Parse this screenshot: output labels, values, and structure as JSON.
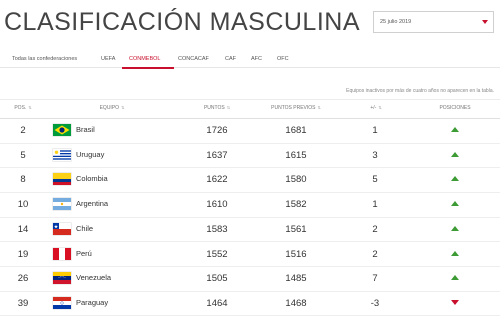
{
  "page": {
    "title": "CLASIFICACIÓN MASCULINA",
    "date": "25 julio 2019",
    "note": "Equipos inactivos por más de cuatro años no aparecen en la tabla."
  },
  "tabs": [
    {
      "label": "Todas las confederaciones",
      "active": false
    },
    {
      "label": "UEFA",
      "active": false
    },
    {
      "label": "CONMEBOL",
      "active": true
    },
    {
      "label": "CONCACAF",
      "active": false
    },
    {
      "label": "CAF",
      "active": false
    },
    {
      "label": "AFC",
      "active": false
    },
    {
      "label": "OFC",
      "active": false
    }
  ],
  "columns": {
    "pos": "POS.",
    "team": "EQUIPO",
    "points": "PUNTOS",
    "prev_points": "PUNTOS PREVIOS",
    "change": "+/-",
    "positions": "POSICIONES"
  },
  "rows": [
    {
      "pos": "2",
      "team": "Brasil",
      "points": "1726",
      "prev": "1681",
      "change": "1",
      "trend": "up",
      "flag": "brazil-flag-icon"
    },
    {
      "pos": "5",
      "team": "Uruguay",
      "points": "1637",
      "prev": "1615",
      "change": "3",
      "trend": "up",
      "flag": "uruguay-flag-icon"
    },
    {
      "pos": "8",
      "team": "Colombia",
      "points": "1622",
      "prev": "1580",
      "change": "5",
      "trend": "up",
      "flag": "colombia-flag-icon"
    },
    {
      "pos": "10",
      "team": "Argentina",
      "points": "1610",
      "prev": "1582",
      "change": "1",
      "trend": "up",
      "flag": "argentina-flag-icon"
    },
    {
      "pos": "14",
      "team": "Chile",
      "points": "1583",
      "prev": "1561",
      "change": "2",
      "trend": "up",
      "flag": "chile-flag-icon"
    },
    {
      "pos": "19",
      "team": "Perú",
      "points": "1552",
      "prev": "1516",
      "change": "2",
      "trend": "up",
      "flag": "peru-flag-icon"
    },
    {
      "pos": "26",
      "team": "Venezuela",
      "points": "1505",
      "prev": "1485",
      "change": "7",
      "trend": "up",
      "flag": "venezuela-flag-icon"
    },
    {
      "pos": "39",
      "team": "Paraguay",
      "points": "1464",
      "prev": "1468",
      "change": "-3",
      "trend": "down",
      "flag": "paraguay-flag-icon"
    }
  ],
  "colors": {
    "accent": "#c8102e",
    "up": "#3d9b35",
    "down": "#c8102e"
  }
}
